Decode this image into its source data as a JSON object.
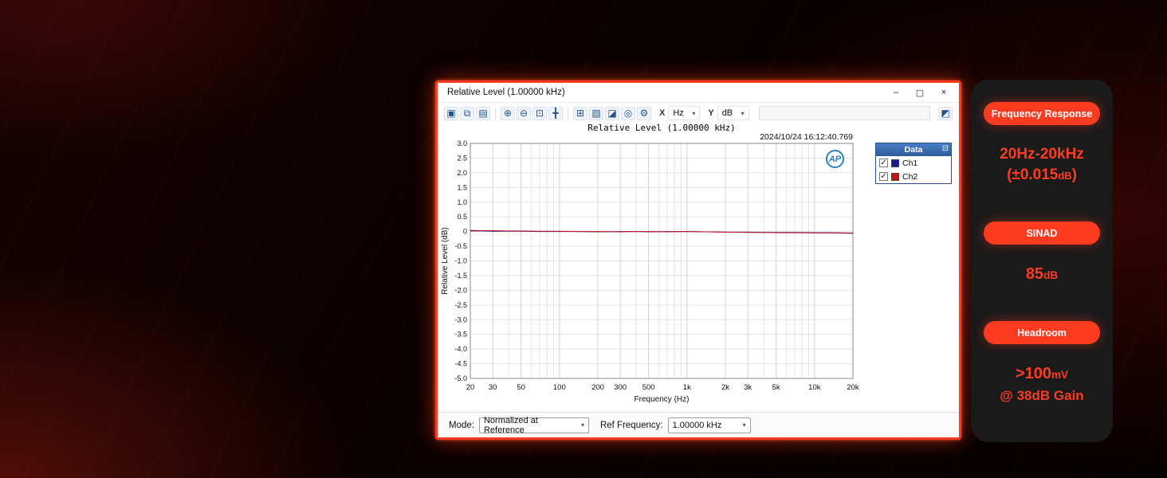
{
  "window": {
    "title": "Relative Level (1.00000 kHz)",
    "minimize": "–",
    "maximize": "▢",
    "close": "×"
  },
  "toolbar": {
    "caret": "▾",
    "x_label": "X",
    "x_value": "Hz",
    "y_label": "Y",
    "y_value": "dB",
    "right_icon": {
      "name": "export-graph-icon",
      "glyph": "◩"
    },
    "icons": [
      {
        "name": "save-icon",
        "glyph": "▣"
      },
      {
        "name": "copy-graph-icon",
        "glyph": "⧉"
      },
      {
        "name": "print-icon",
        "glyph": "▤"
      },
      {
        "sep": true
      },
      {
        "name": "zoom-in-icon",
        "glyph": "⊕"
      },
      {
        "name": "zoom-out-icon",
        "glyph": "⊖"
      },
      {
        "name": "zoom-fit-icon",
        "glyph": "⊡"
      },
      {
        "name": "pan-icon",
        "glyph": "╋"
      },
      {
        "sep": true
      },
      {
        "name": "data-grid-icon",
        "glyph": "⊞"
      },
      {
        "name": "graph-style-icon",
        "glyph": "▧"
      },
      {
        "name": "trace-icon",
        "glyph": "◪"
      },
      {
        "name": "cursor-icon",
        "glyph": "◎"
      },
      {
        "name": "settings-icon",
        "glyph": "⚙"
      }
    ]
  },
  "chart_area": {
    "logo": "AP"
  },
  "legend": {
    "title": "Data",
    "pin_glyph": "⊟",
    "check_glyph": "✓",
    "items": [
      {
        "label": "Ch1",
        "color": "#141b9e",
        "checked": true
      },
      {
        "label": "Ch2",
        "color": "#c81414",
        "checked": true
      }
    ]
  },
  "bottom_bar": {
    "mode_label": "Mode:",
    "mode_value": "Normalized at Reference",
    "ref_label": "Ref Frequency:",
    "ref_value": "1.00000 kHz"
  },
  "side_panel": {
    "accent": "#fd3b20",
    "sections": [
      {
        "pill": "Frequency Response",
        "lines": [
          {
            "fs": 19,
            "parts": [
              {
                "t": "20Hz-20kHz"
              }
            ]
          },
          {
            "fs": 19,
            "parts": [
              {
                "t": "(±0.015"
              },
              {
                "t": "dB",
                "small": true
              },
              {
                "t": ")"
              }
            ]
          }
        ]
      },
      {
        "pill": "SINAD",
        "lines": [
          {
            "fs": 20,
            "parts": [
              {
                "t": "85"
              },
              {
                "t": "dB",
                "small": true
              }
            ]
          }
        ]
      },
      {
        "pill": "Headroom",
        "lines": [
          {
            "fs": 20,
            "parts": [
              {
                "t": ">100"
              },
              {
                "t": "mV",
                "small": true
              }
            ]
          },
          {
            "fs": 17,
            "parts": [
              {
                "t": "@ 38dB Gain"
              }
            ]
          }
        ]
      }
    ]
  },
  "chart_data": {
    "type": "line",
    "title": "Relative Level (1.00000 kHz)",
    "timestamp": "2024/10/24 16:12:40.769",
    "xlabel": "Frequency (Hz)",
    "ylabel": "Relative Level (dB)",
    "x_scale": "log",
    "xlim": [
      20,
      20000
    ],
    "ylim": [
      -5,
      3
    ],
    "grid": true,
    "legend_position": "right",
    "y_tick_step": 0.5,
    "y_tick_labels": [
      "3.0",
      "2.5",
      "2.0",
      "1.5",
      "1.0",
      "0.5",
      "0",
      "-0.5",
      "-1.0",
      "-1.5",
      "-2.0",
      "-2.5",
      "-3.0",
      "-3.5",
      "-4.0",
      "-4.5",
      "-5.0"
    ],
    "x_ticks": [
      [
        20,
        "20"
      ],
      [
        30,
        "30"
      ],
      [
        50,
        "50"
      ],
      [
        100,
        "100"
      ],
      [
        200,
        "200"
      ],
      [
        300,
        "300"
      ],
      [
        500,
        "500"
      ],
      [
        1000,
        "1k"
      ],
      [
        2000,
        "2k"
      ],
      [
        3000,
        "3k"
      ],
      [
        5000,
        "5k"
      ],
      [
        10000,
        "10k"
      ],
      [
        20000,
        "20k"
      ]
    ],
    "series": [
      {
        "name": "Ch1",
        "color": "#141b9e",
        "x": [
          20,
          25,
          30,
          40,
          50,
          70,
          100,
          140,
          200,
          300,
          400,
          500,
          700,
          1000,
          1400,
          2000,
          3000,
          4000,
          5000,
          7000,
          10000,
          14000,
          20000
        ],
        "y": [
          0.02,
          0.02,
          0.01,
          0.01,
          0.01,
          0.0,
          0.0,
          0.0,
          -0.01,
          0.0,
          0.0,
          -0.01,
          0.0,
          0.0,
          -0.01,
          -0.02,
          -0.02,
          -0.03,
          -0.03,
          -0.03,
          -0.04,
          -0.04,
          -0.05
        ]
      },
      {
        "name": "Ch2",
        "color": "#c81414",
        "x": [
          20,
          25,
          30,
          40,
          50,
          70,
          100,
          140,
          200,
          300,
          400,
          500,
          700,
          1000,
          1400,
          2000,
          3000,
          4000,
          5000,
          7000,
          10000,
          14000,
          20000
        ],
        "y": [
          0.04,
          0.03,
          0.03,
          0.02,
          0.02,
          0.01,
          0.01,
          0.0,
          0.0,
          -0.01,
          0.0,
          0.0,
          -0.01,
          0.0,
          -0.01,
          -0.02,
          -0.03,
          -0.03,
          -0.04,
          -0.04,
          -0.05,
          -0.05,
          -0.06
        ]
      }
    ]
  }
}
